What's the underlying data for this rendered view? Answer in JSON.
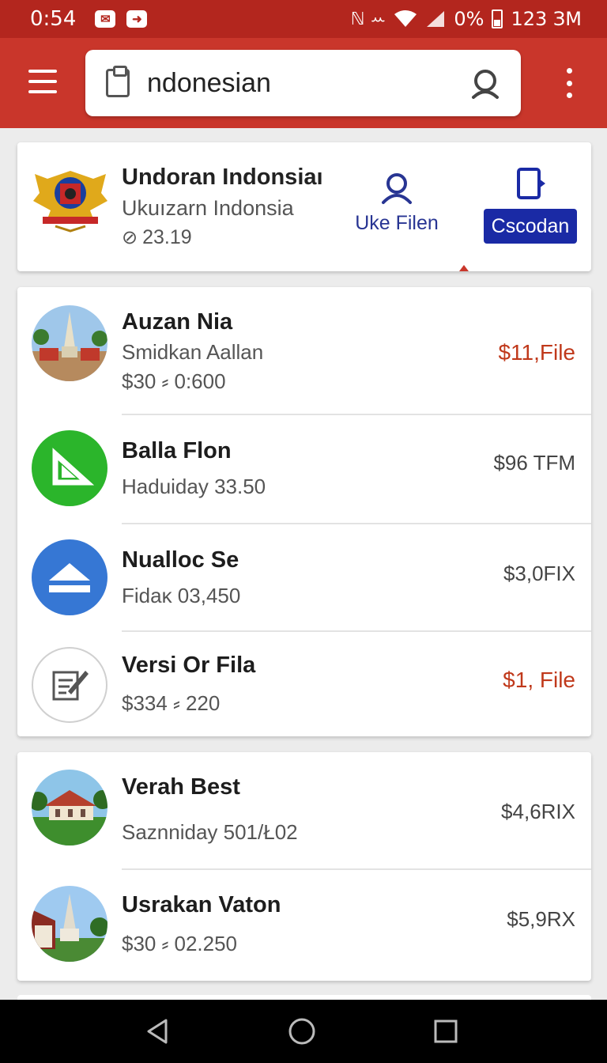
{
  "status_bar": {
    "time": "0:54",
    "left_icons": [
      "mail-icon",
      "forward-icon"
    ],
    "right_glyphs": "ℕ ꕀ",
    "battery": "0%",
    "network": "123 ЗМ"
  },
  "app_bar": {
    "search_value": "ndonesian",
    "icons": [
      "menu-icon",
      "clipboard-icon",
      "search-icon",
      "more-vert-icon"
    ],
    "color": "#c9362b"
  },
  "header_card": {
    "title": "Undoran Indonsiaı",
    "subtitle": "Ukuızarn Indonsia",
    "meta": "23.19",
    "action_1_label": "Uke Filen",
    "action_2_label": "Cscodan",
    "accent": "#1a2aa5"
  },
  "list_1": [
    {
      "title": "Auzan Nia",
      "line1": "Smidkan Aallan",
      "line2": "$30 ⸗ 0:600",
      "price": "$11,File",
      "price_accent": true,
      "avatar": "temple-photo"
    },
    {
      "title": "Balla Flon",
      "line1": "Haduiday 33.50",
      "line2": "",
      "price": "$96 TFM",
      "price_accent": false,
      "avatar": "green-chart-icon"
    },
    {
      "title": "Nualloc Se",
      "line1": "Fidaĸ 03,450",
      "line2": "",
      "price": "$3,0FІX",
      "price_accent": false,
      "avatar": "blue-eject-icon"
    },
    {
      "title": "Versi Or Fila",
      "line1": "$334 ⸗ 220",
      "line2": "",
      "price": "$1, File",
      "price_accent": true,
      "avatar": "edit-icon"
    }
  ],
  "list_2": [
    {
      "title": "Verah Best",
      "line1": "Saznniday 501/Ł02",
      "price": "$4,6RІX",
      "avatar": "house-photo"
    },
    {
      "title": "Usrakan Vaton",
      "line1": "$30 ⸗ 02.250",
      "price": "$5,9RX",
      "avatar": "pagoda-photo"
    }
  ],
  "nav_bar": {
    "icons": [
      "back-icon",
      "home-icon",
      "recents-icon"
    ]
  }
}
